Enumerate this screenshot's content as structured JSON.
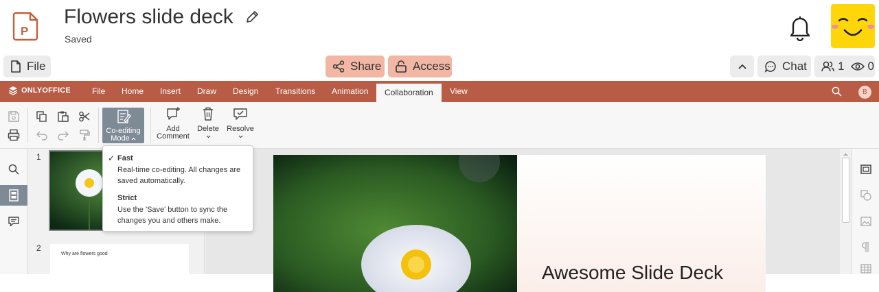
{
  "header": {
    "doc_title": "Flowers slide deck",
    "save_status": "Saved",
    "file_label": "File",
    "share_label": "Share",
    "access_label": "Access",
    "chat_label": "Chat",
    "users_count": "1",
    "viewers_count": "0"
  },
  "editor": {
    "brand": "ONLYOFFICE",
    "user_initial": "B",
    "tabs": [
      "File",
      "Home",
      "Insert",
      "Draw",
      "Design",
      "Transitions",
      "Animation",
      "Collaboration",
      "View"
    ],
    "active_tab": "Collaboration"
  },
  "ribbon": {
    "coedit_line1": "Co-editing",
    "coedit_line2": "Mode",
    "add_comment_line1": "Add",
    "add_comment_line2": "Comment",
    "delete_label": "Delete",
    "resolve_label": "Resolve"
  },
  "coedit_menu": {
    "fast_title": "Fast",
    "fast_desc": "Real-time co-editing. All changes are saved automatically.",
    "strict_title": "Strict",
    "strict_desc": "Use the 'Save' button to sync the changes you and others make."
  },
  "slides": {
    "slide1_number": "1",
    "slide2_number": "2",
    "slide2_text": "Why are flowers good",
    "main_title": "Awesome Slide Deck"
  },
  "colors": {
    "accent": "#b85c45",
    "share_bg": "#f2b7a4",
    "avatar_bg": "#ffd60a"
  }
}
